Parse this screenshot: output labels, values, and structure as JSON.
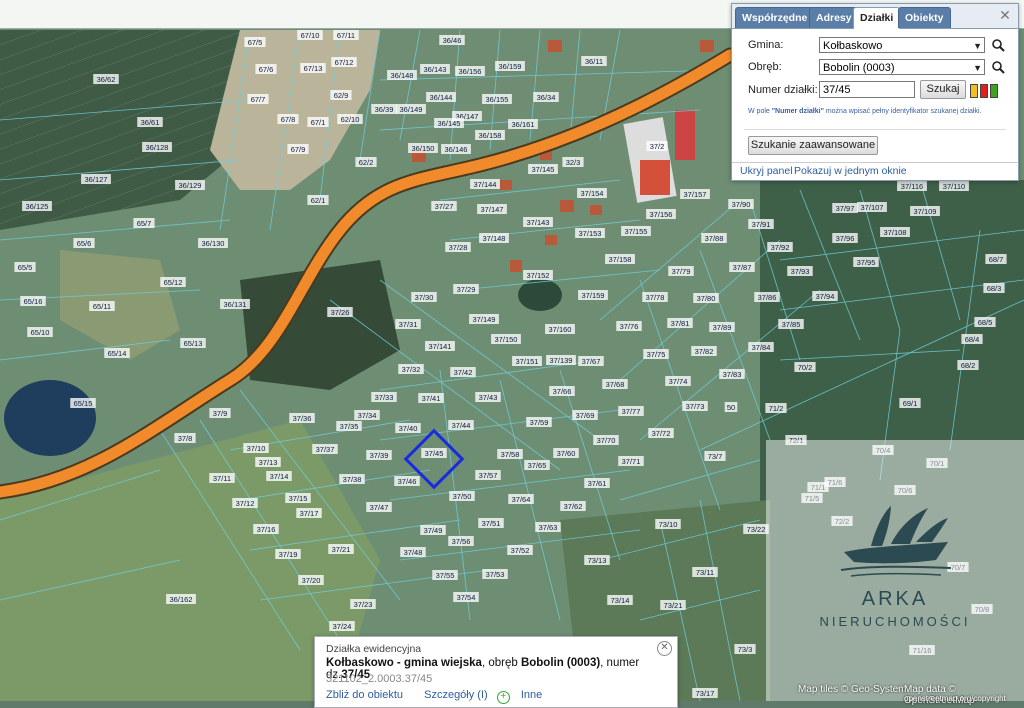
{
  "panel": {
    "tabs": [
      {
        "label": "Współrzędne",
        "active": false
      },
      {
        "label": "Adresy",
        "active": false
      },
      {
        "label": "Działki",
        "active": true
      },
      {
        "label": "Obiekty",
        "active": false
      }
    ],
    "gmina_label": "Gmina:",
    "gmina_value": "Kołbaskowo",
    "obreb_label": "Obręb:",
    "obreb_value": "Bobolin (0003)",
    "numer_label": "Numer działki:",
    "numer_value": "37/45",
    "search_button": "Szukaj",
    "hint_prefix": "W pole ",
    "hint_bold": "\"Numer działki\"",
    "hint_suffix": " można wpisać pełny identyfikator szukanej działki.",
    "advanced_button": "Szukanie zaawansowane",
    "hide_link": "Ukryj panel",
    "show_link": "Pokazuj w jednym oknie",
    "swatch_colors": [
      "#f0c020",
      "#e02020",
      "#40a020"
    ]
  },
  "info": {
    "title": "Działka ewidencyjna",
    "line_bold1": "Kołbaskowo - gmina wiejska",
    "line_mid": ", obręb ",
    "line_bold2": "Bobolin (0003)",
    "line_mid2": ", numer dz.",
    "line_bold3": "37/45",
    "identifier": "321102_2.0003.37/45",
    "link_zoom": "Zbliż do obiektu",
    "link_details": "Szczegóły (I)",
    "link_more": "Inne"
  },
  "watermark": {
    "brand": "ARKA",
    "sub": "NIERUCHOMOŚCI"
  },
  "attribution": {
    "tiles": "Map tiles © Geo-System",
    "data": "Map data © OpenStreetMap",
    "site": "openstreetmap.org/copyright"
  },
  "selected_parcel": "37/45",
  "parcels": [
    "67/5",
    "67/10",
    "67/11",
    "67/6",
    "67/13",
    "67/12",
    "67/7",
    "62/9",
    "67/8",
    "67/1",
    "62/10",
    "67/9",
    "62/2",
    "62/1",
    "36/62",
    "36/61",
    "36/128",
    "36/127",
    "36/125",
    "36/129",
    "36/130",
    "36/131",
    "36/46",
    "36/143",
    "36/148",
    "36/156",
    "36/159",
    "36/144",
    "36/39",
    "36/149",
    "36/155",
    "36/34",
    "36/147",
    "36/145",
    "36/158",
    "36/161",
    "36/150",
    "36/146",
    "36/11",
    "37/2",
    "37/145",
    "32/3",
    "37/144",
    "37/154",
    "37/27",
    "37/147",
    "37/143",
    "37/153",
    "37/155",
    "37/156",
    "37/157",
    "37/148",
    "37/28",
    "37/158",
    "37/152",
    "37/29",
    "37/159",
    "65/7",
    "65/6",
    "65/5",
    "65/12",
    "65/16",
    "65/11",
    "65/10",
    "65/14",
    "65/13",
    "65/15",
    "37/26",
    "37/30",
    "37/31",
    "37/149",
    "37/150",
    "37/160",
    "37/141",
    "37/151",
    "37/139",
    "37/67",
    "37/32",
    "37/42",
    "37/68",
    "37/33",
    "37/41",
    "37/43",
    "37/66",
    "37/34",
    "37/36",
    "37/35",
    "37/40",
    "37/44",
    "37/59",
    "37/69",
    "37/37",
    "37/39",
    "37/45",
    "37/58",
    "37/60",
    "37/70",
    "37/38",
    "37/46",
    "37/57",
    "37/65",
    "37/61",
    "37/47",
    "37/50",
    "37/64",
    "37/62",
    "37/49",
    "37/51",
    "37/63",
    "37/56",
    "37/48",
    "37/52",
    "37/55",
    "37/53",
    "37/54",
    "37/21",
    "37/20",
    "37/23",
    "37/24",
    "37/19",
    "37/16",
    "37/15",
    "37/17",
    "37/12",
    "37/14",
    "37/13",
    "37/11",
    "37/10",
    "37/9",
    "37/8",
    "36/162",
    "37/79",
    "37/80",
    "37/78",
    "37/81",
    "37/76",
    "37/82",
    "37/75",
    "37/74",
    "37/73",
    "37/77",
    "37/72",
    "37/71",
    "37/83",
    "37/84",
    "37/85",
    "37/86",
    "37/87",
    "37/88",
    "37/90",
    "37/91",
    "37/92",
    "37/93",
    "37/94",
    "37/89",
    "37/96",
    "37/95",
    "37/97",
    "37/107",
    "37/108",
    "37/109",
    "37/110",
    "37/116",
    "70/2",
    "71/2",
    "70/4",
    "70/1",
    "72/1",
    "71/1",
    "71/6",
    "70/6",
    "70/7",
    "71/5",
    "72/2",
    "70/8",
    "71/16",
    "73/7",
    "73/10",
    "73/11",
    "73/13",
    "73/14",
    "73/21",
    "73/22",
    "73/3",
    "73/17",
    "68/7",
    "68/5",
    "68/4",
    "68/3",
    "68/2",
    "69/1",
    "50"
  ]
}
